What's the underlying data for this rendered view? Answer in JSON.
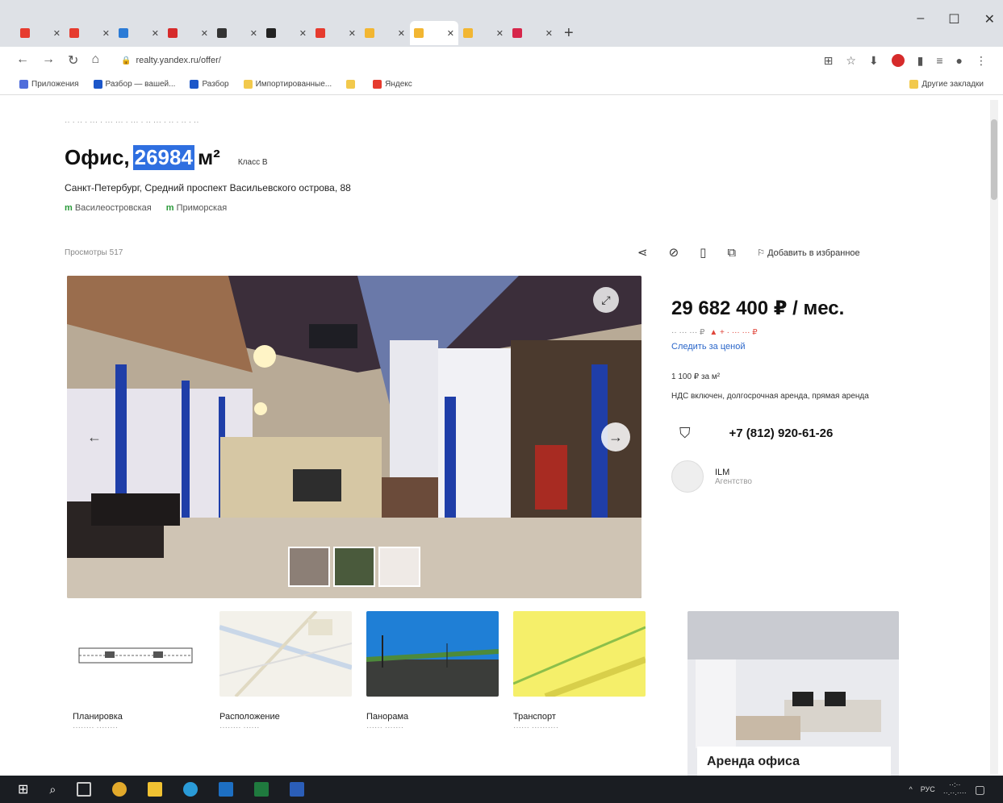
{
  "browser": {
    "tabs": [
      {
        "label": "",
        "color": "#e63b2e",
        "active": false
      },
      {
        "label": "",
        "color": "#e63b2e",
        "active": false
      },
      {
        "label": "",
        "color": "#2b7bd6",
        "active": false
      },
      {
        "label": "",
        "color": "#d62b2b",
        "active": false
      },
      {
        "label": "",
        "color": "#333333",
        "active": false
      },
      {
        "label": "",
        "color": "#222222",
        "active": false
      },
      {
        "label": "",
        "color": "#e63b2e",
        "active": false
      },
      {
        "label": "",
        "color": "#f2b632",
        "active": false
      },
      {
        "label": "",
        "color": "#f2b632",
        "active": true
      },
      {
        "label": "",
        "color": "#f2b632",
        "active": false
      },
      {
        "label": "",
        "color": "#d6264a",
        "active": false
      }
    ],
    "url": "realty.yandex.ru/offer/",
    "bookmarks": [
      {
        "label": "Приложения",
        "color": "#4f6ddb"
      },
      {
        "label": "Разбор — вашей...",
        "color": "#1c57c9"
      },
      {
        "label": "Разбор",
        "color": "#1c57c9"
      },
      {
        "label": "Импортированные...",
        "color": "#f2c94c"
      },
      {
        "label": "",
        "color": "#f2c94c"
      },
      {
        "label": "Яндекс",
        "color": "#e63b2e"
      }
    ],
    "other_bookmarks": "Другие закладки"
  },
  "listing": {
    "title_prefix": "Офис,",
    "area_value": "26984",
    "area_unit": "м²",
    "class_label": "Класс B",
    "address": "Санкт-Петербург, Средний проспект Васильевского острова, 88",
    "metro1": "Василеостровская",
    "metro2": "Приморская",
    "views_label": "Просмотры",
    "views_count": "517",
    "favorite_label": "Добавить в избранное"
  },
  "price": {
    "main": "29 682 400 ₽ / мес.",
    "follow": "Следить за ценой",
    "per_meter": "1 100 ₽ за м²",
    "terms": "НДС включен, долгосрочная аренда, прямая аренда",
    "phone": "+7 (812) 920-61-26",
    "agent_name": "ILM",
    "agent_role": "Агентство"
  },
  "cards": [
    {
      "caption": "Планировка"
    },
    {
      "caption": "Расположение"
    },
    {
      "caption": "Панорама"
    },
    {
      "caption": "Транспорт"
    }
  ],
  "ad": {
    "title": "Аренда офиса"
  },
  "taskbar": {
    "lang": "РУС"
  }
}
